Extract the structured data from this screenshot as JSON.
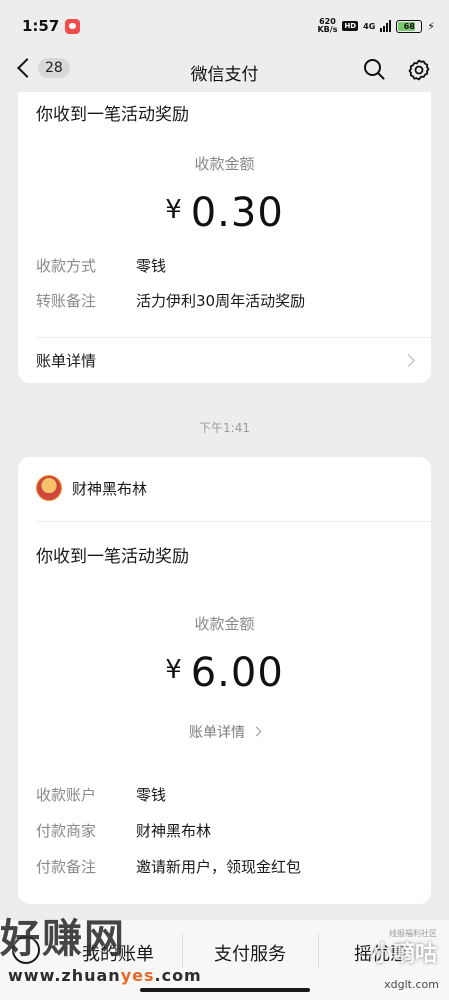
{
  "status_bar": {
    "time": "1:57",
    "net_speed_value": "620",
    "net_speed_unit": "KB/s",
    "hd": "HD",
    "signal_label": "4G",
    "battery": "68"
  },
  "nav": {
    "unread_count": "28",
    "title": "微信支付",
    "search_icon": "search-icon",
    "settings_icon": "gear-icon"
  },
  "card1": {
    "headline": "你收到一笔活动奖励",
    "amount_label": "收款金额",
    "currency": "¥",
    "amount": "0.30",
    "rows": [
      {
        "label": "收款方式",
        "value": "零钱"
      },
      {
        "label": "转账备注",
        "value": "活力伊利30周年活动奖励"
      }
    ],
    "detail_link": "账单详情"
  },
  "timestamp": "下午1:41",
  "card2": {
    "merchant_name": "财神黑布林",
    "headline": "你收到一笔活动奖励",
    "amount_label": "收款金额",
    "currency": "¥",
    "amount": "6.00",
    "detail_link": "账单详情",
    "rows": [
      {
        "label": "收款账户",
        "value": "零钱"
      },
      {
        "label": "付款商家",
        "value": "财神黑布林"
      },
      {
        "label": "付款备注",
        "value": "邀请新用户，领现金红包"
      }
    ]
  },
  "bottom_bar": {
    "tabs": [
      "我的账单",
      "支付服务",
      "摇优惠"
    ]
  },
  "watermarks": {
    "left_logo": "好赚网",
    "left_url_a": "www.zhuan",
    "left_url_b": "yes",
    "left_url_c": ".com",
    "right_small": "线报福利社区",
    "right_logo": "小嘀咕",
    "right_url": "xdglt.com"
  },
  "colors": {
    "background": "#ededed",
    "card": "#ffffff",
    "label_gray": "#8a8a8a"
  }
}
